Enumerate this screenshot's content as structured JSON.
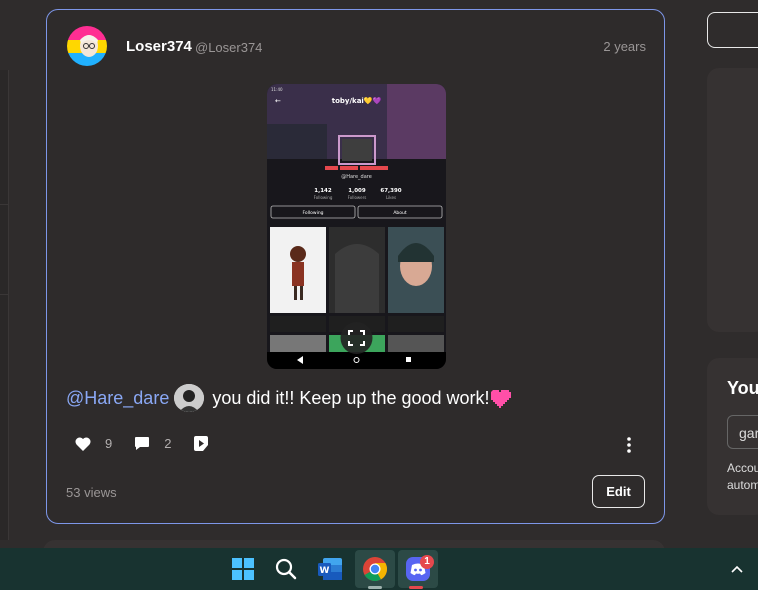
{
  "post": {
    "username": "Loser374",
    "handle": "@Loser374",
    "time": "2 years",
    "mention": "@Hare_dare",
    "text": "you did it!! Keep up the good work!",
    "likes": "9",
    "comments": "2",
    "views": "53 views",
    "edit_label": "Edit"
  },
  "screenshot": {
    "profile_title": "toby/kai💛💜",
    "profile_handle": "@Hare_dare",
    "stats": [
      {
        "value": "1,142",
        "label": "Following"
      },
      {
        "value": "1,009",
        "label": "Followers"
      },
      {
        "value": "67,390",
        "label": "Likes"
      }
    ],
    "following_label": "Following",
    "about_label": "About"
  },
  "right_panel": {
    "card_title": "You",
    "input_value": "gar",
    "text_line1": "Accou",
    "text_line2": "autom"
  },
  "taskbar": {
    "discord_badge": "1"
  },
  "colors": {
    "accent_border": "#7d96e8",
    "mention": "#8aa8f5",
    "background": "#2f2c2c",
    "taskbar": "#183330"
  }
}
